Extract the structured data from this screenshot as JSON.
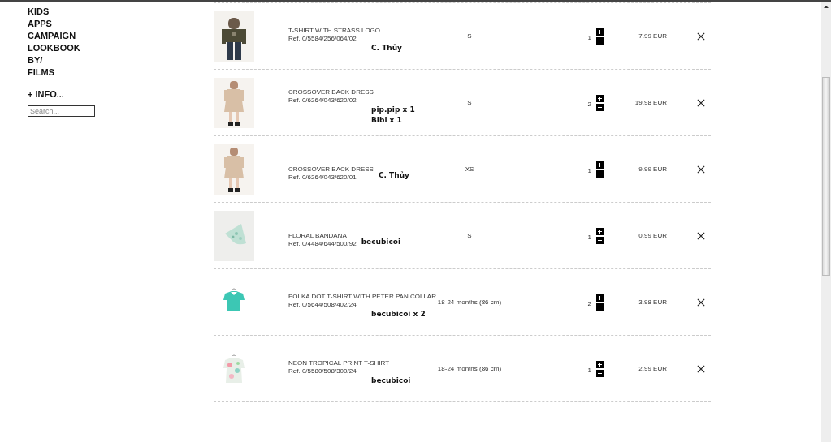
{
  "sidebar": {
    "nav": [
      "KIDS",
      "APPS",
      "CAMPAIGN",
      "LOOKBOOK",
      "BY/",
      "FILMS"
    ],
    "info": "+ INFO...",
    "search": {
      "placeholder": "Search..."
    }
  },
  "cart": [
    {
      "name": "T-SHIRT WITH STRASS LOGO",
      "ref": "Ref. 0/5584/256/064/02",
      "note": [
        "C. Thủy"
      ],
      "kind": "below",
      "size": "S",
      "qty": "1",
      "price": "7.99 EUR"
    },
    {
      "name": "CROSSOVER BACK DRESS",
      "ref": "Ref. 0/6264/043/620/02",
      "note": [
        "pip.pip x 1",
        "Bibi x 1"
      ],
      "kind": "below",
      "size": "S",
      "qty": "2",
      "price": "19.98 EUR"
    },
    {
      "name": "CROSSOVER BACK DRESS",
      "ref": "Ref. 0/6264/043/620/01",
      "note": [
        "C. Thủy"
      ],
      "kind": "beside",
      "size": "XS",
      "qty": "1",
      "price": "9.99 EUR"
    },
    {
      "name": "FLORAL BANDANA",
      "ref": "Ref. 0/4484/644/500/92",
      "note": [
        "becubicoi"
      ],
      "kind": "beside",
      "size": "S",
      "qty": "1",
      "price": "0.99 EUR"
    },
    {
      "name": "POLKA DOT T-SHIRT WITH PETER PAN COLLAR",
      "ref": "Ref. 0/5644/508/402/24",
      "note": [
        "becubicoi x 2"
      ],
      "kind": "below",
      "size": "18-24 months (86 cm)",
      "qty": "2",
      "price": "3.98 EUR"
    },
    {
      "name": "NEON TROPICAL PRINT T-SHIRT",
      "ref": "Ref. 0/5580/508/300/24",
      "note": [
        "becubicoi"
      ],
      "kind": "below",
      "size": "18-24 months (86 cm)",
      "qty": "1",
      "price": "2.99 EUR"
    }
  ]
}
